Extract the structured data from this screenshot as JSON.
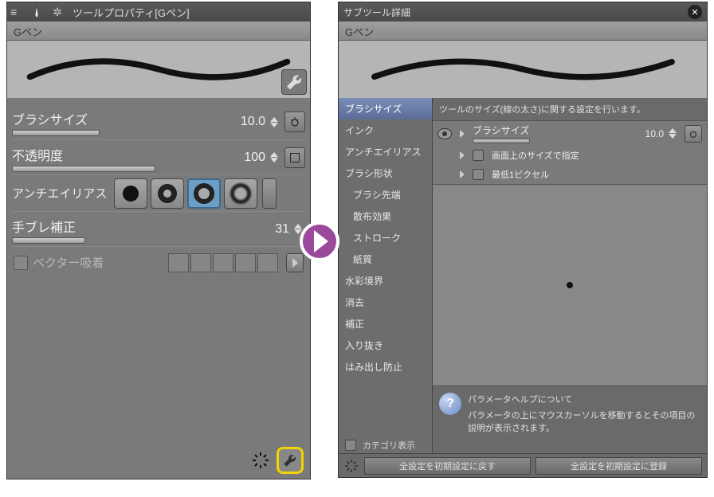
{
  "left": {
    "title": "ツールプロパティ[Gペン]",
    "tool_name": "Gペン",
    "brush_size_label": "ブラシサイズ",
    "brush_size_value": "10.0",
    "opacity_label": "不透明度",
    "opacity_value": "100",
    "aa_label": "アンチエイリアス",
    "stabilize_label": "手ブレ補正",
    "stabilize_value": "31",
    "vector_label": "ベクター吸着"
  },
  "right": {
    "title": "サブツール詳細",
    "tool_name": "Gペン",
    "categories": [
      "ブラシサイズ",
      "インク",
      "アンチエイリアス",
      "ブラシ形状",
      "ブラシ先端",
      "散布効果",
      "ストローク",
      "紙質",
      "水彩境界",
      "消去",
      "補正",
      "入り抜き",
      "はみ出し防止"
    ],
    "selected_category": 0,
    "description": "ツールのサイズ(線の太さ)に関する設定を行います。",
    "brush_size_label": "ブラシサイズ",
    "brush_size_value": "10.0",
    "screen_size_label": "画面上のサイズで指定",
    "min1px_label": "最低1ピクセル",
    "help_title": "パラメータヘルプについて",
    "help_body": "パラメータの上にマウスカーソルを移動するとその項目の説明が表示されます。",
    "category_show_label": "カテゴリ表示",
    "reset_btn": "全設定を初期設定に戻す",
    "register_btn": "全設定を初期設定に登録"
  }
}
